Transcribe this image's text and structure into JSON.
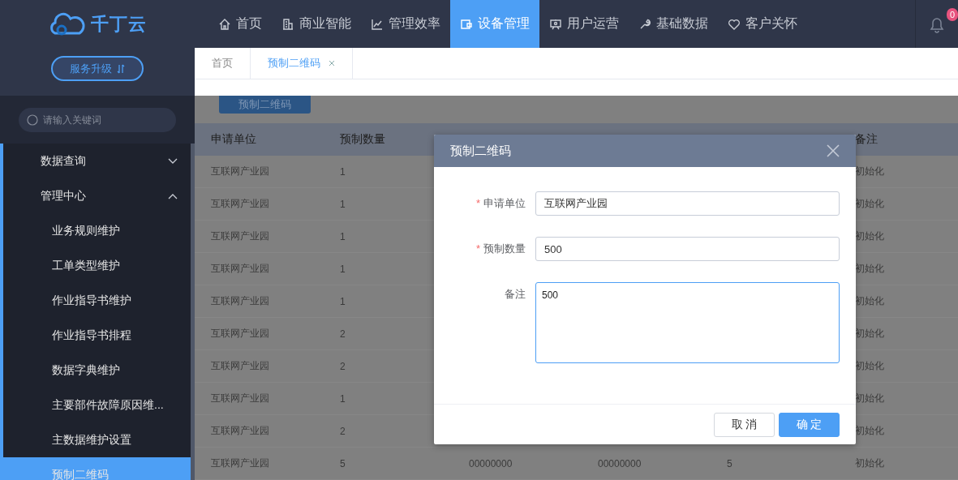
{
  "logo": {
    "text": "千丁云"
  },
  "upgrade_button": {
    "label": "服务升级"
  },
  "nav": [
    {
      "label": "首页",
      "selected": false
    },
    {
      "label": "商业智能",
      "selected": false
    },
    {
      "label": "管理效率",
      "selected": false
    },
    {
      "label": "设备管理",
      "selected": true
    },
    {
      "label": "用户运营",
      "selected": false
    },
    {
      "label": "基础数据",
      "selected": false
    },
    {
      "label": "客户关怀",
      "selected": false
    }
  ],
  "notifications": {
    "count": "0"
  },
  "tabs": [
    {
      "label": "首页",
      "selected": false,
      "closable": false
    },
    {
      "label": "预制二维码",
      "selected": true,
      "closable": true
    }
  ],
  "search": {
    "placeholder": "请输入关键词"
  },
  "sidebar": {
    "items": [
      {
        "label": "数据查询",
        "expanded": false
      },
      {
        "label": "管理中心",
        "expanded": true,
        "children": [
          {
            "label": "业务规则维护",
            "selected": false
          },
          {
            "label": "工单类型维护",
            "selected": false
          },
          {
            "label": "作业指导书维护",
            "selected": false
          },
          {
            "label": "作业指导书排程",
            "selected": false
          },
          {
            "label": "数据字典维护",
            "selected": false
          },
          {
            "label": "主要部件故障原因维...",
            "selected": false
          },
          {
            "label": "主数据维护设置",
            "selected": false
          },
          {
            "label": "预制二维码",
            "selected": true
          }
        ]
      }
    ]
  },
  "toolbar": {
    "button": "预制二维码"
  },
  "table": {
    "columns": [
      "申请单位",
      "预制数量",
      null,
      null,
      null,
      "备注"
    ],
    "rows": [
      [
        "互联网产业园",
        "1",
        null,
        null,
        null,
        "初始化"
      ],
      [
        "互联网产业园",
        "1",
        null,
        null,
        null,
        "初始化"
      ],
      [
        "互联网产业园",
        "1",
        null,
        null,
        null,
        "初始化"
      ],
      [
        "互联网产业园",
        "1",
        null,
        null,
        null,
        "初始化"
      ],
      [
        "互联网产业园",
        "1",
        null,
        null,
        null,
        "初始化"
      ],
      [
        "互联网产业园",
        "2",
        null,
        null,
        null,
        "初始化"
      ],
      [
        "互联网产业园",
        "2",
        null,
        null,
        null,
        "初始化"
      ],
      [
        "互联网产业园",
        "1",
        null,
        null,
        null,
        "初始化"
      ],
      [
        "互联网产业园",
        "2",
        null,
        null,
        null,
        "初始化"
      ],
      [
        "互联网产业园",
        "5",
        "00000000",
        "00000000",
        "5",
        "初始化"
      ]
    ]
  },
  "dialog": {
    "title": "预制二维码",
    "fields": [
      {
        "label": "申请单位",
        "required_mark": "*",
        "kind": "input",
        "value": "互联网产业园",
        "focused": false
      },
      {
        "label": "预制数量",
        "required_mark": "*",
        "kind": "input",
        "value": "500",
        "focused": false
      },
      {
        "label": "备注",
        "kind": "textarea",
        "value": "500",
        "focused": true
      }
    ],
    "buttons": [
      {
        "label": "取 消",
        "primary": false
      },
      {
        "label": "确 定",
        "primary": true
      }
    ]
  }
}
